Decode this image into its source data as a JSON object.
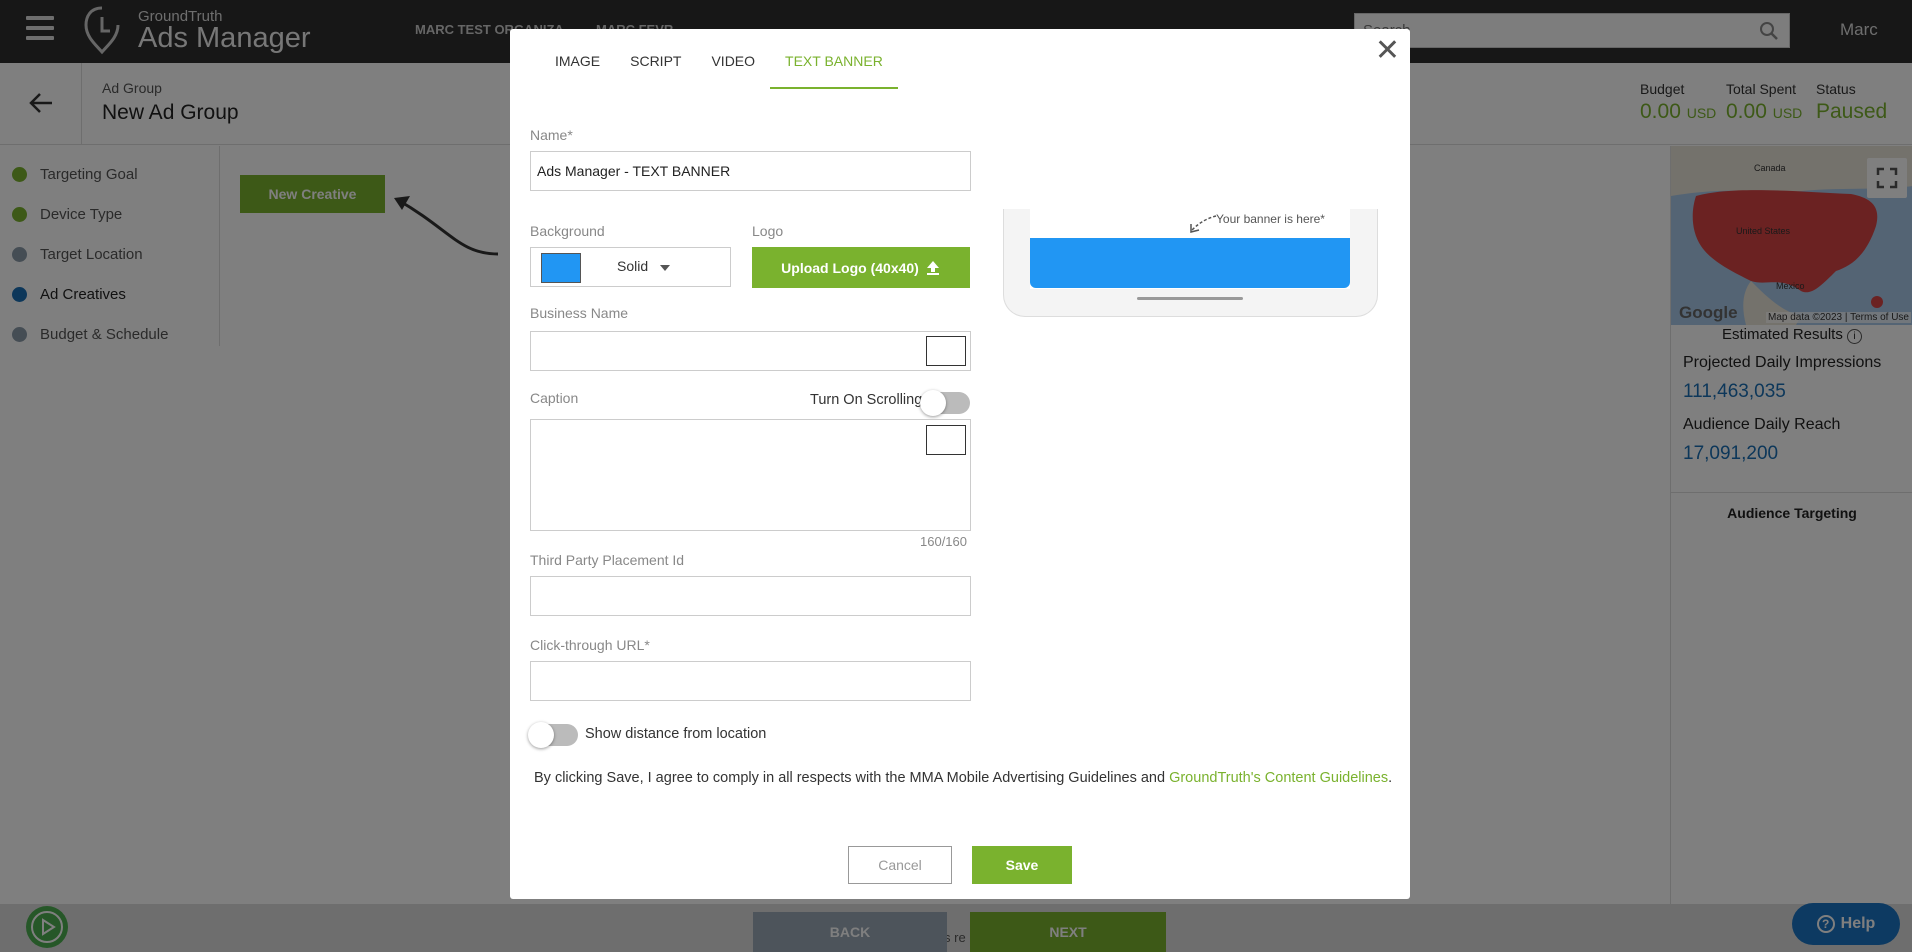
{
  "app": {
    "brand_sub": "GroundTruth",
    "brand_main": "Ads Manager",
    "orgs": [
      "MARC TEST ORGANIZA",
      "MARC FEVR"
    ],
    "search_placeholder": "Search",
    "user": "Marc"
  },
  "subheader": {
    "crumb_label": "Ad Group",
    "crumb_title": "New Ad Group",
    "stats": [
      {
        "label": "Budget",
        "value": "0.00",
        "unit": "USD"
      },
      {
        "label": "Total Spent",
        "value": "0.00",
        "unit": "USD"
      },
      {
        "label": "Status",
        "value": "Paused"
      }
    ]
  },
  "leftnav": {
    "items": [
      {
        "label": "Targeting Goal",
        "color": "#7ab22e"
      },
      {
        "label": "Device Type",
        "color": "#7ab22e"
      },
      {
        "label": "Target Location",
        "color": "#8a9aa8"
      },
      {
        "label": "Ad Creatives",
        "color": "#1a6fb4"
      },
      {
        "label": "Budget & Schedule",
        "color": "#8a9aa8"
      }
    ]
  },
  "main": {
    "new_creative_label": "New Creative"
  },
  "rightpanel": {
    "map_labels": [
      "Canada",
      "United States",
      "Mexico"
    ],
    "google": "Google",
    "map_credit": "Map data ©2023",
    "terms": "Terms of Use",
    "estimated_title": "Estimated Results",
    "projected_label": "Projected Daily Impressions",
    "projected_value": "111,463,035",
    "reach_label": "Audience Daily Reach",
    "reach_value": "17,091,200",
    "audience_targeting": "Audience Targeting"
  },
  "footer": {
    "back_label": "BACK",
    "next_label": "NEXT",
    "help_label": "Help",
    "hidden_text": "s re"
  },
  "modal": {
    "tabs": [
      "IMAGE",
      "SCRIPT",
      "VIDEO",
      "TEXT BANNER"
    ],
    "active_tab": "TEXT BANNER",
    "name_label": "Name*",
    "name_value": "Ads Manager - TEXT BANNER",
    "background_label": "Background",
    "background_type": "Solid",
    "background_color": "#2196f3",
    "logo_label": "Logo",
    "upload_logo_label": "Upload Logo (40x40)",
    "business_name_label": "Business Name",
    "business_name_value": "",
    "caption_label": "Caption",
    "scrolling_label": "Turn On Scrolling",
    "char_count": "160/160",
    "third_party_label": "Third Party Placement Id",
    "click_url_label": "Click-through URL*",
    "distance_label": "Show distance from location",
    "banner_note": "Your banner is here*",
    "agree_prefix": "By clicking Save, I agree to comply in all respects with the MMA Mobile Advertising Guidelines and ",
    "agree_link": "GroundTruth's Content Guidelines",
    "agree_suffix": ".",
    "cancel_label": "Cancel",
    "save_label": "Save",
    "accent_color": "#7ab22e"
  }
}
